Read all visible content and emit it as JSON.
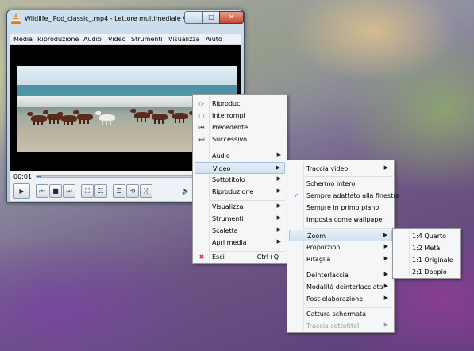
{
  "window": {
    "title": "Wildlife_iPod_classic_.mp4 - Lettore multimediale VLC",
    "min_glyph": "–",
    "max_glyph": "□",
    "close_glyph": "✕"
  },
  "menubar": [
    "Media",
    "Riproduzione",
    "Audio",
    "Video",
    "Strumenti",
    "Visualizza",
    "Aiuto"
  ],
  "seek": {
    "time": "00:01",
    "progress": 0.03
  },
  "controls": {
    "play": "▶",
    "prev": "⏮",
    "stop": "■",
    "next": "⏭",
    "fullscreen": "⛶",
    "extended": "☷",
    "playlist": "☰",
    "loop": "⟲",
    "random": "⤮",
    "volume": "🔉"
  },
  "context_menu": {
    "items": [
      {
        "label": "Riproduci",
        "icon": "▷"
      },
      {
        "label": "Interrompi",
        "icon": "□"
      },
      {
        "label": "Precedente",
        "icon": "⏮"
      },
      {
        "label": "Successivo",
        "icon": "⏭"
      },
      {
        "label": "Audio"
      },
      {
        "label": "Video",
        "highlighted": true
      },
      {
        "label": "Sottotitolo"
      },
      {
        "label": "Riproduzione"
      },
      {
        "label": "Visualizza"
      },
      {
        "label": "Strumenti"
      },
      {
        "label": "Scaletta"
      },
      {
        "label": "Apri media"
      },
      {
        "label": "Esci",
        "shortcut": "Ctrl+Q",
        "icon": "✖"
      }
    ]
  },
  "video_menu": {
    "items": [
      {
        "label": "Traccia video"
      },
      {
        "label": "Schermo intero"
      },
      {
        "label": "Sempre adattato alla finestra",
        "checked": true,
        "check": "✓"
      },
      {
        "label": "Sempre in primo piano"
      },
      {
        "label": "Imposta come wallpaper"
      },
      {
        "label": "Zoom",
        "highlighted": true
      },
      {
        "label": "Proporzioni"
      },
      {
        "label": "Ritaglia"
      },
      {
        "label": "Deinterlaccia"
      },
      {
        "label": "Modalità deinterlacciata"
      },
      {
        "label": "Post-elaborazione"
      },
      {
        "label": "Cattura schermata"
      },
      {
        "label": "Traccia sottotitoli",
        "disabled": true
      }
    ]
  },
  "zoom_menu": {
    "items": [
      {
        "label": "1:4 Quarto"
      },
      {
        "label": "1:2 Metà"
      },
      {
        "label": "1:1 Originale"
      },
      {
        "label": "2:1 Doppio"
      }
    ]
  },
  "colors": {
    "highlight": "#d2e0f0",
    "close_button": "#c4462d",
    "vlc_orange": "#f08a1c"
  }
}
